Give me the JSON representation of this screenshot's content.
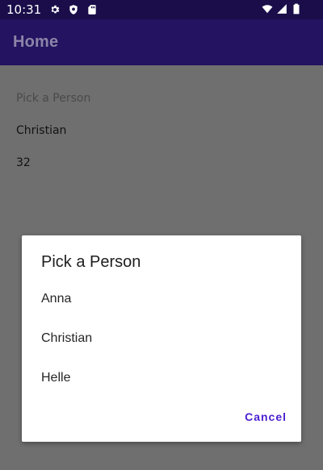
{
  "status_bar": {
    "time": "10:31",
    "icons_left": [
      "settings-icon",
      "shield-icon",
      "sd-card-icon"
    ],
    "icons_right": [
      "wifi-icon",
      "signal-icon",
      "battery-icon"
    ]
  },
  "app_bar": {
    "title": "Home"
  },
  "content": {
    "picker_title": "Pick a Person",
    "selected_value": "Christian",
    "age_value": "32"
  },
  "dialog": {
    "title": "Pick a Person",
    "options": [
      "Anna",
      "Christian",
      "Helle"
    ],
    "cancel_label": "Cancel"
  },
  "colors": {
    "status_bar": "#1a0d4a",
    "app_bar": "#231360",
    "scrim": "#6f6f6f",
    "accent": "#4b1fd0"
  }
}
